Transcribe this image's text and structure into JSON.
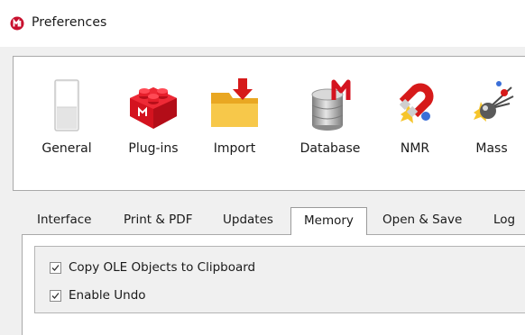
{
  "window": {
    "title": "Preferences",
    "icon": "mestrenova-app-icon"
  },
  "toolbar": {
    "items": [
      {
        "label": "General",
        "icon": "general-switch-icon"
      },
      {
        "label": "Plug-ins",
        "icon": "plugins-brick-icon"
      },
      {
        "label": "Import",
        "icon": "import-folder-icon"
      },
      {
        "label": "Database",
        "icon": "database-icon"
      },
      {
        "label": "NMR",
        "icon": "nmr-magnet-icon"
      },
      {
        "label": "Mass",
        "icon": "mass-molecule-icon"
      }
    ]
  },
  "tabs": {
    "items": [
      "Interface",
      "Print & PDF",
      "Updates",
      "Memory",
      "Open & Save",
      "Log"
    ],
    "active": "Memory"
  },
  "memory": {
    "options": [
      {
        "label": "Copy OLE Objects to Clipboard",
        "checked": true
      },
      {
        "label": "Enable Undo",
        "checked": true
      }
    ]
  },
  "colors": {
    "accent": "#c8102e",
    "window_bg": "#f0f0f0",
    "panel_border": "#a9a9a9"
  }
}
